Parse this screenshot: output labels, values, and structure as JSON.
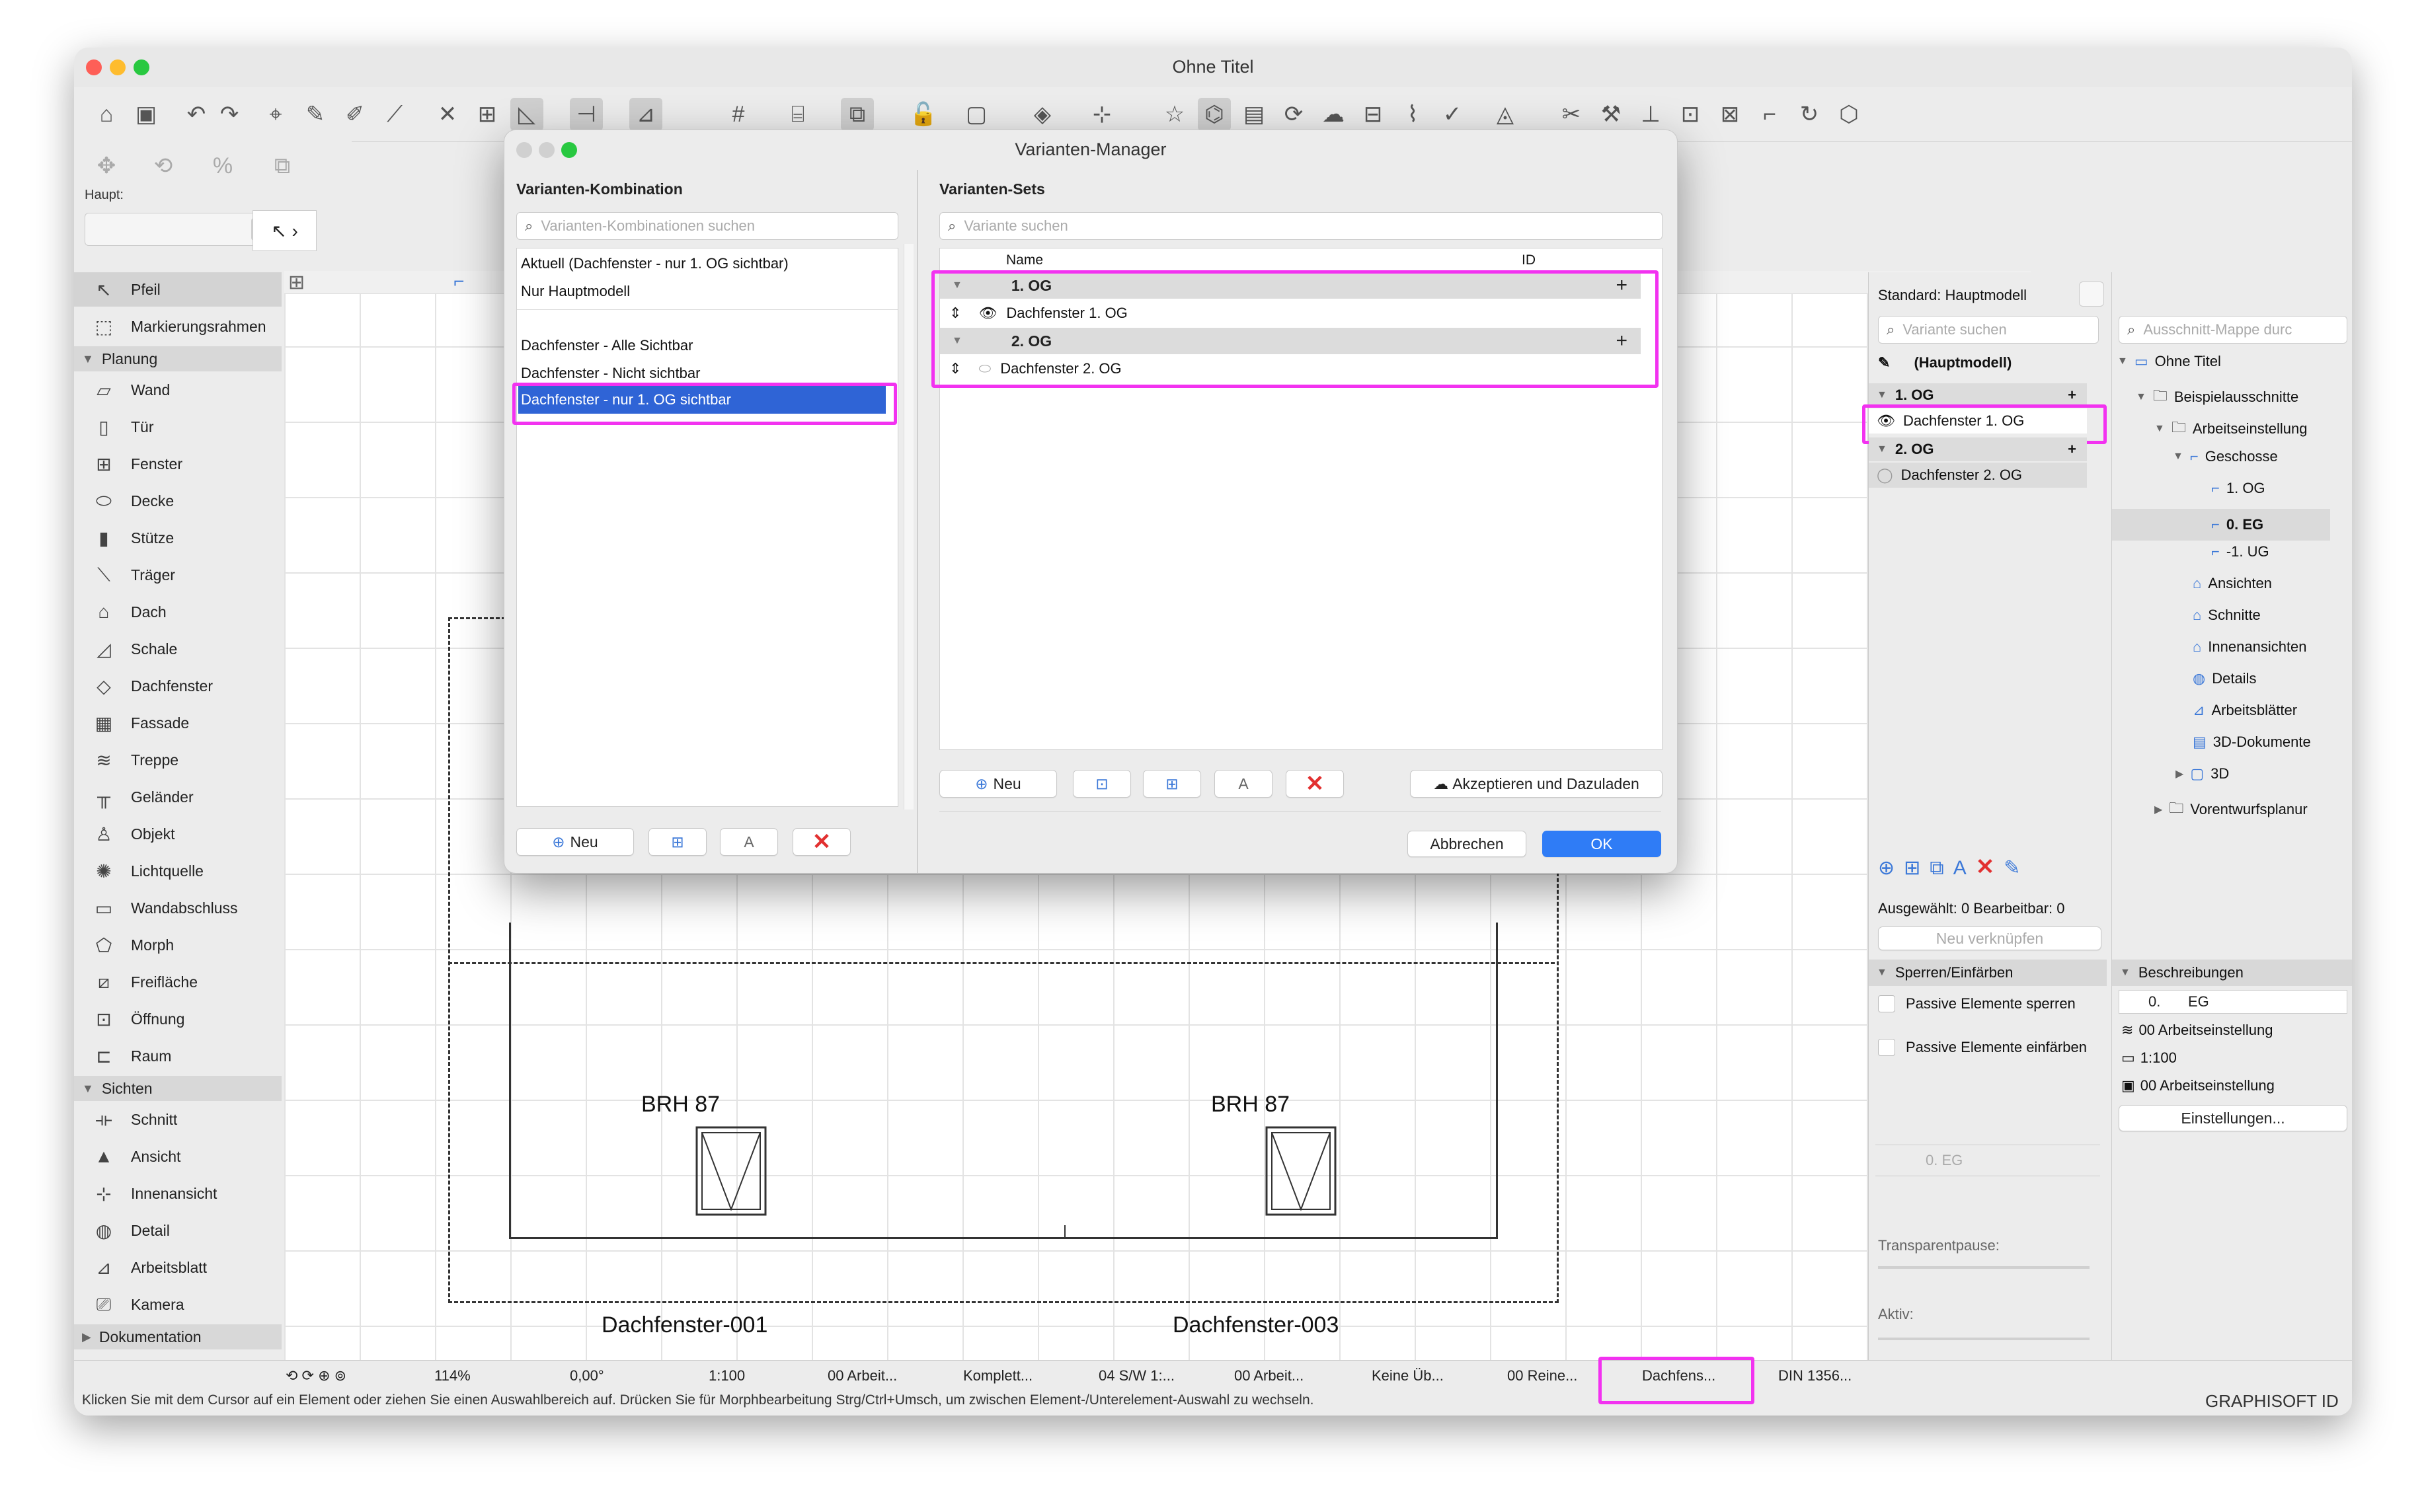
{
  "window": {
    "title": "Ohne Titel"
  },
  "toolbar2": {
    "label": "Haupt:"
  },
  "toolbox": {
    "items": [
      {
        "label": "Pfeil"
      },
      {
        "label": "Markierungsrahmen"
      }
    ],
    "section_planung": "Planung",
    "planung": [
      "Wand",
      "Tür",
      "Fenster",
      "Decke",
      "Stütze",
      "Träger",
      "Dach",
      "Schale",
      "Dachfenster",
      "Fassade",
      "Treppe",
      "Geländer",
      "Objekt",
      "Lichtquelle",
      "Wandabschluss",
      "Morph",
      "Freifläche",
      "Öffnung",
      "Raum"
    ],
    "section_sichten": "Sichten",
    "sichten": [
      "Schnitt",
      "Ansicht",
      "Innenansicht",
      "Detail",
      "Arbeitsblatt",
      "Kamera"
    ],
    "section_dokumentation": "Dokumentation"
  },
  "canvas": {
    "brh1": "BRH 87",
    "brh2": "BRH 87",
    "win1": "Dachfenster-001",
    "win2": "Dachfenster-003"
  },
  "dialog": {
    "title": "Varianten-Manager",
    "left_title": "Varianten-Kombination",
    "left_search": "Varianten-Kombinationen suchen",
    "combos": [
      "Aktuell (Dachfenster - nur 1. OG sichtbar)",
      "Nur Hauptmodell",
      "Dachfenster - Alle Sichtbar",
      "Dachfenster - Nicht sichtbar",
      "Dachfenster - nur 1. OG sichtbar"
    ],
    "left_new": "Neu",
    "right_title": "Varianten-Sets",
    "right_search": "Variante suchen",
    "col_name": "Name",
    "col_id": "ID",
    "sets": [
      {
        "group": "1. OG",
        "variant": "Dachfenster 1. OG"
      },
      {
        "group": "2. OG",
        "variant": "Dachfenster 2. OG"
      }
    ],
    "right_new": "Neu",
    "accept": "Akzeptieren und Dazuladen",
    "cancel": "Abbrechen",
    "ok": "OK"
  },
  "navpanel": {
    "standard": "Standard: Hauptmodell",
    "search": "Variante suchen",
    "hauptmodell": "(Hauptmodell)",
    "g1": "1. OG",
    "v1": "Dachfenster 1. OG",
    "g2": "2. OG",
    "v2": "Dachfenster 2. OG",
    "selected": "Ausgewählt: 0 Bearbeitbar: 0",
    "link_new": "Neu verknüpfen",
    "lock_section": "Sperren/Einfärben",
    "lock1": "Passive Elemente sperren",
    "lock2": "Passive Elemente einfärben",
    "story": "0. EG",
    "transparent": "Transparentpause:",
    "active": "Aktiv:"
  },
  "viewpanel": {
    "search": "Ausschnitt-Mappe durc",
    "tree": [
      {
        "label": "Ohne Titel",
        "level": 0
      },
      {
        "label": "Beispielausschnitte",
        "level": 1
      },
      {
        "label": "Arbeitseinstellung",
        "level": 2
      },
      {
        "label": "Geschosse",
        "level": 3
      },
      {
        "label": "1. OG",
        "level": 4
      },
      {
        "label": "0. EG",
        "level": 4
      },
      {
        "label": "-1. UG",
        "level": 4
      },
      {
        "label": "Ansichten",
        "level": 3
      },
      {
        "label": "Schnitte",
        "level": 3
      },
      {
        "label": "Innenansichten",
        "level": 3
      },
      {
        "label": "Details",
        "level": 3
      },
      {
        "label": "Arbeitsblätter",
        "level": 3
      },
      {
        "label": "3D-Dokumente",
        "level": 3
      },
      {
        "label": "3D",
        "level": 3
      },
      {
        "label": "Vorentwurfsplanur",
        "level": 2
      }
    ],
    "desc_section": "Beschreibungen",
    "desc_num": "0.",
    "desc_name": "EG",
    "p1": "00 Arbeitseinstellung",
    "p2": "1:100",
    "p3": "00 Arbeitseinstellung",
    "settings": "Einstellungen..."
  },
  "statusbar": {
    "zoom": "114%",
    "angle": "0,00°",
    "scale": "1:100",
    "s1": "00 Arbeit...",
    "s2": "Komplett...",
    "s3": "04 S/W 1:...",
    "s4": "00 Arbeit...",
    "s5": "Keine Üb...",
    "s6": "00 Reine...",
    "s7": "Dachfens...",
    "s8": "DIN 1356...",
    "hint": "Klicken Sie mit dem Cursor auf ein Element oder ziehen Sie einen Auswahlbereich auf. Drücken Sie für Morphbearbeitung Strg/Ctrl+Umsch, um zwischen Element-/Unterelement-Auswahl zu wechseln.",
    "graphisoft": "GRAPHISOFT ID"
  },
  "colors": {
    "accent": "#2f7cf6",
    "highlight": "#f232f0",
    "delete": "#e23030"
  }
}
